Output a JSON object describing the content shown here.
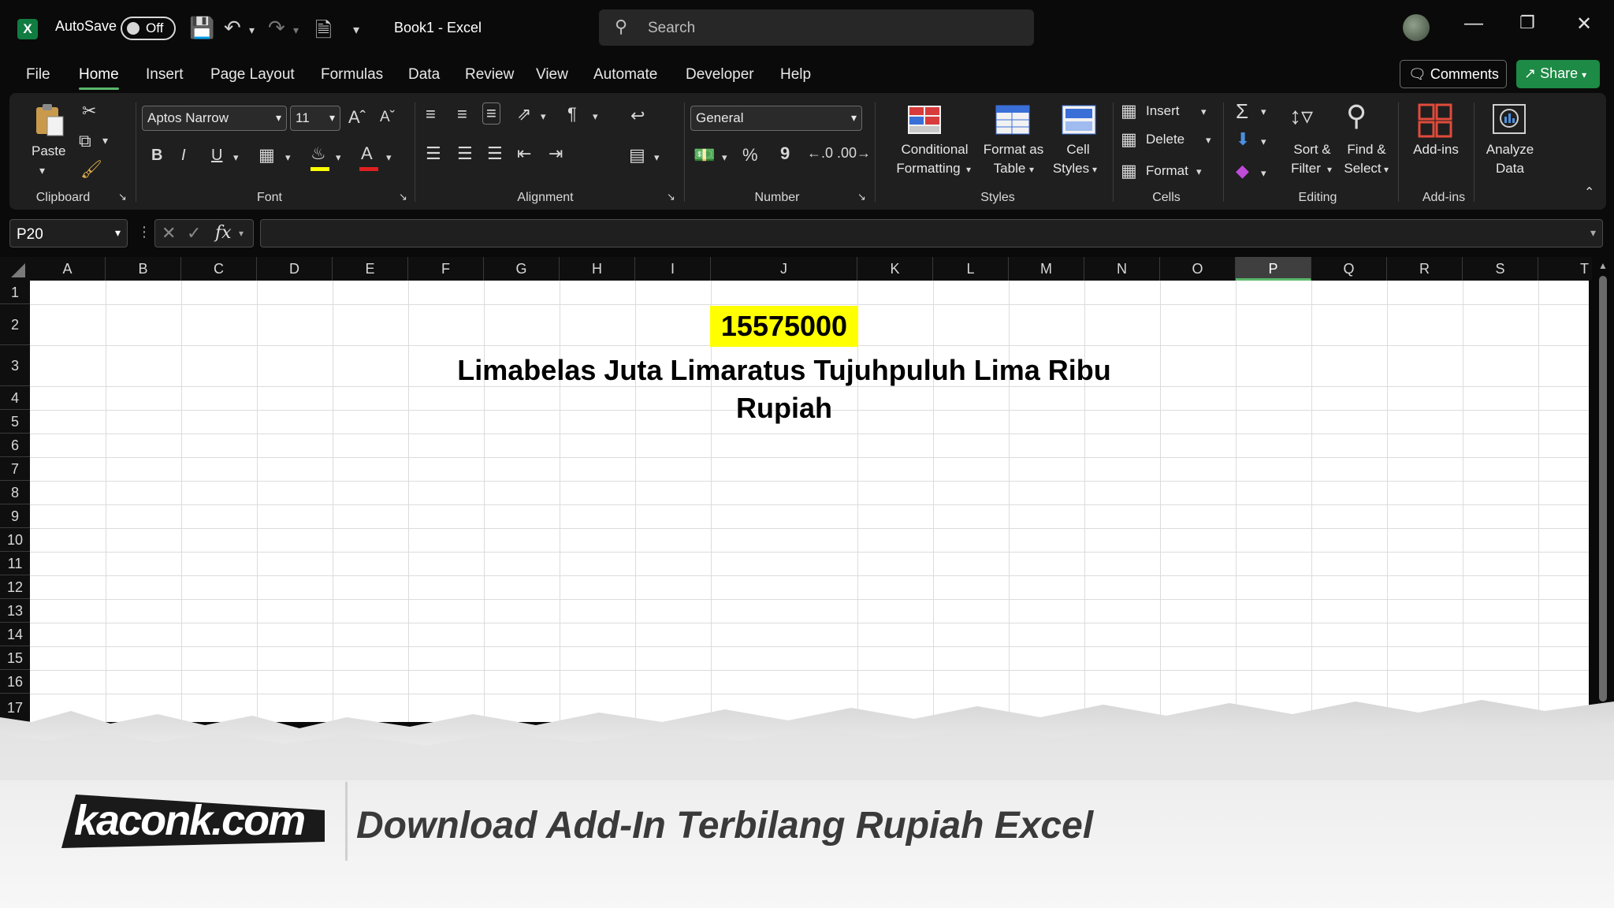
{
  "titlebar": {
    "app_icon": "X",
    "autosave_label": "AutoSave",
    "autosave_state": "Off",
    "doc_title": "Book1  -  Excel",
    "search_placeholder": "Search"
  },
  "menu": {
    "items": [
      "File",
      "Home",
      "Insert",
      "Page Layout",
      "Formulas",
      "Data",
      "Review",
      "View",
      "Automate",
      "Developer",
      "Help"
    ],
    "active": "Home",
    "comments_label": "Comments",
    "share_label": "Share"
  },
  "ribbon": {
    "clipboard": {
      "paste_label": "Paste",
      "group_label": "Clipboard"
    },
    "font": {
      "font_name": "Aptos Narrow",
      "font_size": "11",
      "bold": "B",
      "italic": "I",
      "underline": "U",
      "font_color_letter": "A",
      "group_label": "Font"
    },
    "alignment": {
      "group_label": "Alignment"
    },
    "number": {
      "format": "General",
      "percent": "%",
      "comma": "9",
      "group_label": "Number"
    },
    "styles": {
      "conditional_1": "Conditional",
      "conditional_2": "Formatting",
      "format_table_1": "Format as",
      "format_table_2": "Table",
      "cell_styles_1": "Cell",
      "cell_styles_2": "Styles",
      "group_label": "Styles"
    },
    "cells": {
      "insert": "Insert",
      "delete": "Delete",
      "format": "Format",
      "group_label": "Cells"
    },
    "editing": {
      "sort_1": "Sort &",
      "sort_2": "Filter",
      "find_1": "Find &",
      "find_2": "Select",
      "group_label": "Editing"
    },
    "addins": {
      "addins_label": "Add-ins",
      "analyze_1": "Analyze",
      "analyze_2": "Data",
      "group_label": "Add-ins"
    },
    "accent_color": "#5ab86a"
  },
  "formula_bar": {
    "name_box": "P20",
    "fx": "fx",
    "content": ""
  },
  "grid": {
    "columns": [
      "A",
      "B",
      "C",
      "D",
      "E",
      "F",
      "G",
      "H",
      "I",
      "J",
      "K",
      "L",
      "M",
      "N",
      "O",
      "P",
      "Q",
      "R",
      "S",
      "T"
    ],
    "selected_column": "P",
    "rows": [
      "1",
      "2",
      "3",
      "4",
      "5",
      "6",
      "7",
      "8",
      "9",
      "10",
      "11",
      "12",
      "13",
      "14",
      "15",
      "16",
      "17"
    ],
    "cell_J2": "15575000",
    "cell_J3": "Limabelas Juta Limaratus Tujuhpuluh Lima Ribu Rupiah",
    "highlight_color": "#ffff00"
  },
  "banner": {
    "brand": "kaconk.com",
    "tagline": "Download Add-In Terbilang Rupiah Excel"
  }
}
